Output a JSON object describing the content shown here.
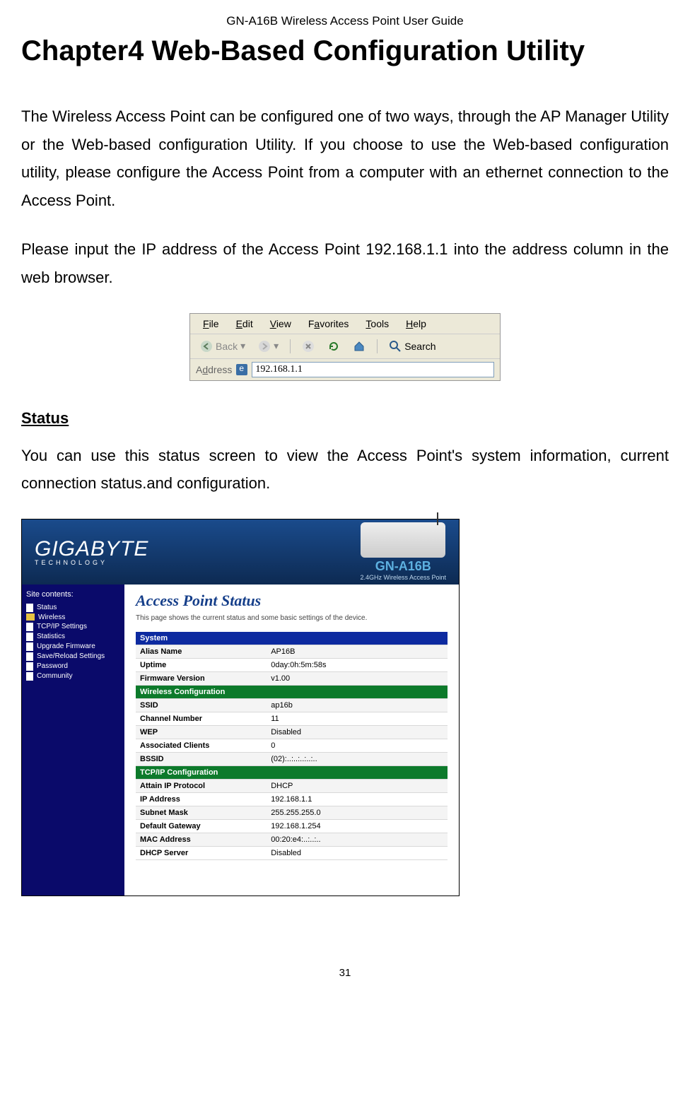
{
  "header": "GN-A16B Wireless Access Point User Guide",
  "chapterTitle": "Chapter4 Web-Based Configuration Utility",
  "para1": "The Wireless Access Point can be configured one of two ways, through the AP Manager Utility or the Web-based configuration Utility. If you choose to use the Web-based configuration utility, please configure the Access Point from a computer with an ethernet connection to the Access Point.",
  "para2": "Please input the IP address of the Access Point 192.168.1.1 into the address column in the web browser.",
  "browser": {
    "menu": [
      "File",
      "Edit",
      "View",
      "Favorites",
      "Tools",
      "Help"
    ],
    "back": "Back",
    "search": "Search",
    "addressLabel": "Address",
    "addressValue": "192.168.1.1"
  },
  "statusHeading": "Status",
  "statusPara": "You can use this status screen to view the Access Point's system information, current connection status.and configuration.",
  "banner": {
    "brand": "GIGABYTE",
    "brandSub": "TECHNOLOGY",
    "productName": "GN-A16B",
    "productDesc": "2.4GHz Wireless Access Point"
  },
  "sidebar": {
    "title": "Site contents:",
    "items": [
      {
        "icon": "page",
        "label": "Status"
      },
      {
        "icon": "folder",
        "label": "Wireless"
      },
      {
        "icon": "page",
        "label": "TCP/IP Settings"
      },
      {
        "icon": "page",
        "label": "Statistics"
      },
      {
        "icon": "page",
        "label": "Upgrade Firmware"
      },
      {
        "icon": "page",
        "label": "Save/Reload Settings"
      },
      {
        "icon": "page",
        "label": "Password"
      },
      {
        "icon": "page",
        "label": "Community"
      }
    ]
  },
  "panel": {
    "title": "Access Point Status",
    "desc": "This page shows the current status and some basic settings of the device.",
    "sections": [
      {
        "header": "System",
        "rows": [
          {
            "k": "Alias Name",
            "v": "AP16B"
          },
          {
            "k": "Uptime",
            "v": "0day:0h:5m:58s"
          },
          {
            "k": "Firmware Version",
            "v": "v1.00"
          }
        ]
      },
      {
        "header": "Wireless Configuration",
        "rows": [
          {
            "k": "SSID",
            "v": "ap16b"
          },
          {
            "k": "Channel Number",
            "v": "11"
          },
          {
            "k": "WEP",
            "v": "Disabled"
          },
          {
            "k": "Associated Clients",
            "v": "0"
          },
          {
            "k": "BSSID",
            "v": "(02):..:..:..:..:.."
          }
        ]
      },
      {
        "header": "TCP/IP Configuration",
        "rows": [
          {
            "k": "Attain IP Protocol",
            "v": "DHCP"
          },
          {
            "k": "IP Address",
            "v": "192.168.1.1"
          },
          {
            "k": "Subnet Mask",
            "v": "255.255.255.0"
          },
          {
            "k": "Default Gateway",
            "v": "192.168.1.254"
          },
          {
            "k": "MAC Address",
            "v": "00:20:e4:..:..:.."
          },
          {
            "k": "DHCP Server",
            "v": "Disabled"
          }
        ]
      }
    ]
  },
  "pageNumber": "31"
}
